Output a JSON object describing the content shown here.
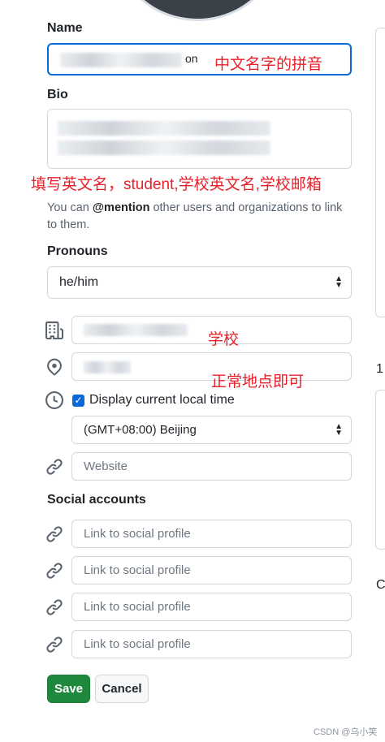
{
  "form": {
    "name_label": "Name",
    "name_value_visible": "on",
    "bio_label": "Bio",
    "helper_prefix": "You can ",
    "helper_mention": "@mention",
    "helper_suffix": " other users and organizations to link to them.",
    "pronouns_label": "Pronouns",
    "pronouns_value": "he/him",
    "display_local_time_label": "Display current local time",
    "display_local_time_checked": true,
    "timezone_value": "(GMT+08:00) Beijing",
    "website_placeholder": "Website",
    "social_accounts_label": "Social accounts",
    "social_placeholders": [
      "Link to social profile",
      "Link to social profile",
      "Link to social profile",
      "Link to social profile"
    ],
    "save_label": "Save",
    "cancel_label": "Cancel"
  },
  "annotations": {
    "name_note": "中文名字的拼音",
    "bio_note": "填写英文名，student,学校英文名,学校邮箱",
    "company_note": "学校",
    "location_note": "正常地点即可"
  },
  "right_edge": {
    "char_1": "1",
    "char_2": "C"
  },
  "watermark": "CSDN @乌小笑",
  "colors": {
    "accent": "#0969da",
    "save_green": "#1f883d",
    "annotation_red": "#e8202a"
  },
  "icons": [
    "organization-icon",
    "location-pin-icon",
    "clock-icon",
    "link-icon"
  ]
}
